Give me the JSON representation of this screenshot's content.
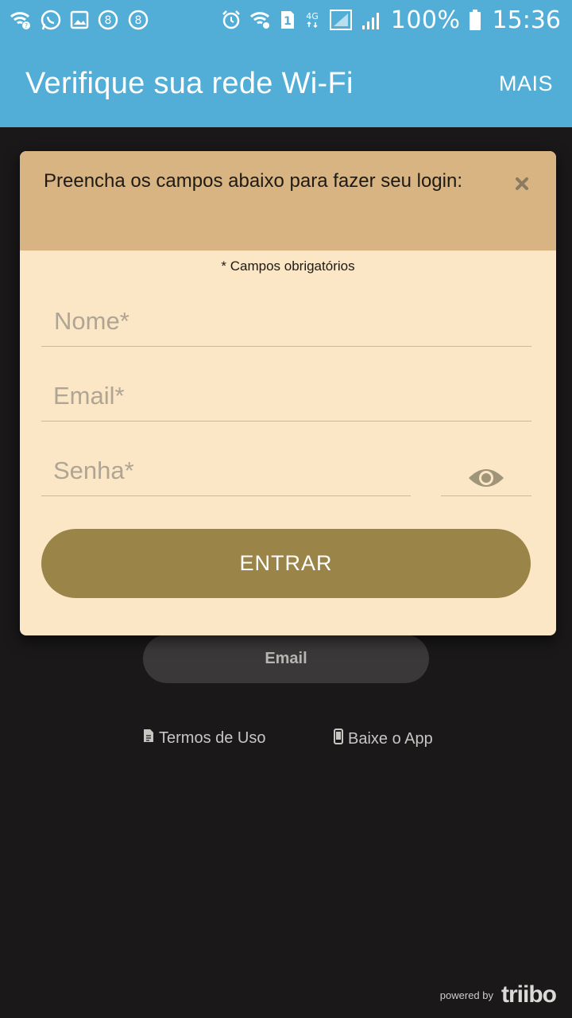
{
  "status_bar": {
    "battery_percent": "100%",
    "time": "15:36",
    "network_type": "4G",
    "sim_slot": "1",
    "notification_icons": [
      "wifi-question-icon",
      "whatsapp-icon",
      "gallery-icon",
      "app-8-icon",
      "app-8-icon"
    ],
    "system_icons": [
      "alarm-icon",
      "wifi-icon",
      "sim-1-icon",
      "4g-icon",
      "signal-icon",
      "signal-icon",
      "battery-icon"
    ]
  },
  "app_bar": {
    "title": "Verifique sua rede Wi-Fi",
    "more_label": "MAIS"
  },
  "modal": {
    "title": "Preencha os campos abaixo para fazer seu login:",
    "required_note": "* Campos obrigatórios",
    "fields": {
      "name_placeholder": "Nome*",
      "email_placeholder": "Email*",
      "password_placeholder": "Senha*"
    },
    "submit_label": "ENTRAR"
  },
  "background": {
    "email_button_label": "Email",
    "terms_label": "Termos de Uso",
    "download_label": "Baixe o App",
    "powered_label": "powered by",
    "brand": "triibo"
  },
  "colors": {
    "app_bar": "#52aed6",
    "background": "#1a1819",
    "modal_header": "#d9b483",
    "modal_body": "#fbe7c6",
    "primary_button": "#9a8447"
  }
}
